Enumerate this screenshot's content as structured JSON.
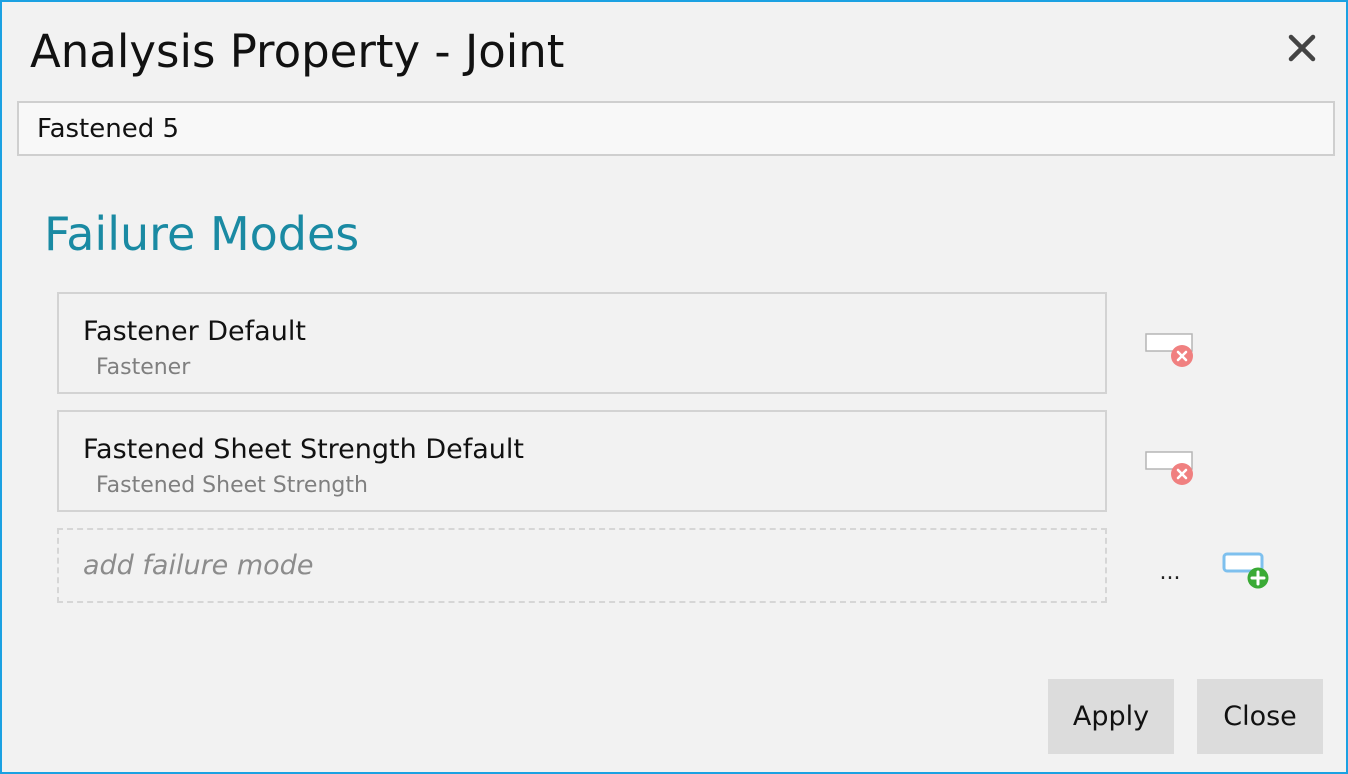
{
  "dialog": {
    "title": "Analysis Property - Joint",
    "close_icon": "close-icon"
  },
  "name_field": {
    "value": "Fastened 5"
  },
  "section": {
    "title": "Failure Modes"
  },
  "failure_modes": [
    {
      "name": "Fastener Default",
      "type": "Fastener",
      "remove_icon": "remove-item-icon"
    },
    {
      "name": "Fastened Sheet Strength Default",
      "type": "Fastened Sheet Strength",
      "remove_icon": "remove-item-icon"
    }
  ],
  "add_mode": {
    "placeholder": "add failure mode",
    "browse_label": "...",
    "add_icon": "add-item-icon"
  },
  "footer": {
    "apply_label": "Apply",
    "close_label": "Close"
  },
  "colors": {
    "window_border": "#1ba1e2",
    "section_title": "#1a8aa3",
    "remove_badge": "#f08080",
    "add_badge": "#3aaa35",
    "add_frame": "#7ec0ee"
  }
}
